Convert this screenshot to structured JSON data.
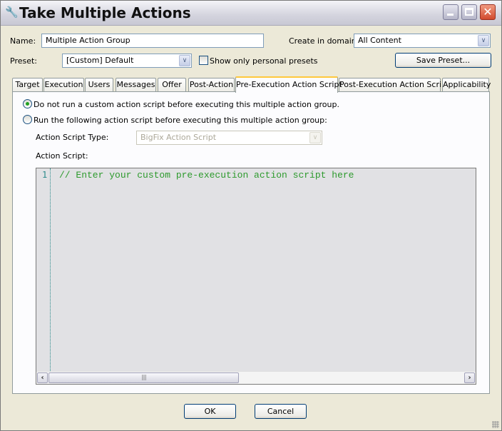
{
  "window": {
    "title": "Take Multiple Actions",
    "title_icon": "wrench-icon",
    "controls": {
      "minimize": "minimize-icon",
      "maximize": "maximize-icon",
      "close": "close-icon"
    }
  },
  "form": {
    "name_label": "Name:",
    "name_value": "Multiple Action Group",
    "domain_label": "Create in domain:",
    "domain_value": "All Content",
    "preset_label": "Preset:",
    "preset_value": "[Custom] Default",
    "personal_presets_label": "Show only personal presets",
    "personal_presets_checked": false,
    "save_preset_label": "Save Preset..."
  },
  "tabs": [
    {
      "label": "Target",
      "active": false
    },
    {
      "label": "Execution",
      "active": false
    },
    {
      "label": "Users",
      "active": false
    },
    {
      "label": "Messages",
      "active": false
    },
    {
      "label": "Offer",
      "active": false
    },
    {
      "label": "Post-Action",
      "active": false
    },
    {
      "label": "Pre-Execution Action Script",
      "active": true
    },
    {
      "label": "Post-Execution Action Script",
      "active": false
    },
    {
      "label": "Applicability",
      "active": false
    }
  ],
  "panel": {
    "radio_no_script": {
      "label": "Do not run a custom action script before executing this multiple action group.",
      "selected": true
    },
    "radio_run_script": {
      "label": "Run the following action script before executing this multiple action group:",
      "selected": false
    },
    "script_type_label": "Action Script Type:",
    "script_type_value": "BigFix Action Script",
    "script_label": "Action Script:",
    "editor": {
      "line_numbers": [
        "1"
      ],
      "lines": [
        "// Enter your custom pre-execution action script here"
      ]
    }
  },
  "footer": {
    "ok_label": "OK",
    "cancel_label": "Cancel"
  }
}
